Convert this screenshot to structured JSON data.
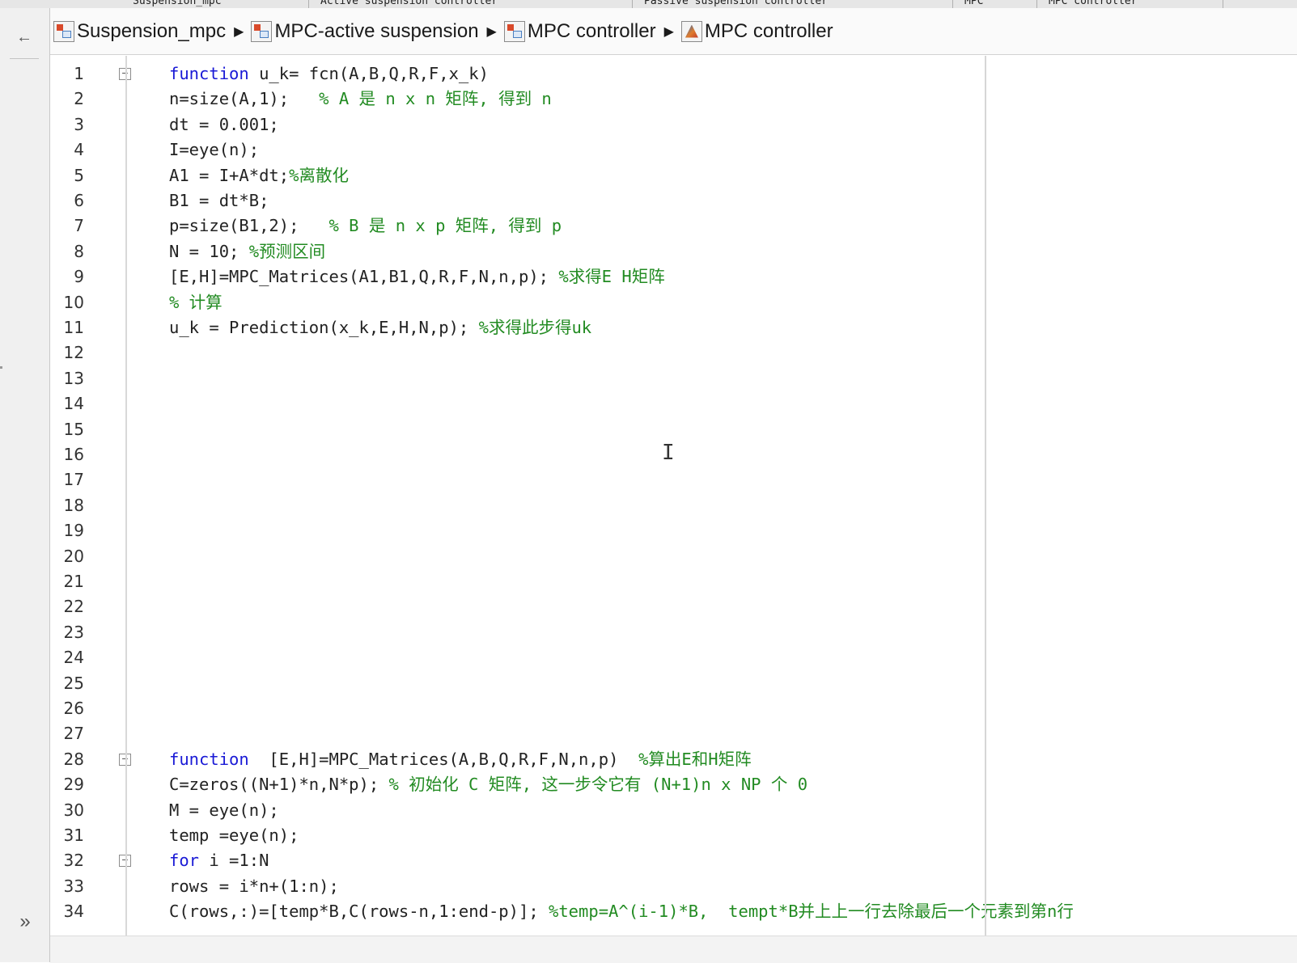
{
  "tabs": [
    {
      "label": "Suspension_mpc"
    },
    {
      "label": "Active suspension controller"
    },
    {
      "label": "Passive suspension controller"
    },
    {
      "label": "MPC"
    },
    {
      "label": "MPC controller"
    }
  ],
  "nav": {
    "back_icon": "back-arrow-icon",
    "expand_icon": "double-chevron-right-icon"
  },
  "breadcrumb": [
    {
      "label": "Suspension_mpc",
      "icon": "simulink-model-icon"
    },
    {
      "label": "MPC-active suspension",
      "icon": "subsystem-icon"
    },
    {
      "label": "MPC controller",
      "icon": "subsystem-icon"
    },
    {
      "label": "MPC controller",
      "icon": "matlab-function-icon"
    }
  ],
  "code": [
    {
      "n": "1",
      "fold": true,
      "kw": "function",
      "text": " u_k= fcn(A,B,Q,R,F,x_k)",
      "comment": ""
    },
    {
      "n": "2",
      "fold": false,
      "kw": "",
      "text": "n=size(A,1);   ",
      "comment": "% A 是 n x n 矩阵, 得到 n"
    },
    {
      "n": "3",
      "fold": false,
      "kw": "",
      "text": "dt = 0.001;",
      "comment": ""
    },
    {
      "n": "4",
      "fold": false,
      "kw": "",
      "text": "I=eye(n);",
      "comment": ""
    },
    {
      "n": "5",
      "fold": false,
      "kw": "",
      "text": "A1 = I+A*dt;",
      "comment": "%离散化"
    },
    {
      "n": "6",
      "fold": false,
      "kw": "",
      "text": "B1 = dt*B;",
      "comment": ""
    },
    {
      "n": "7",
      "fold": false,
      "kw": "",
      "text": "p=size(B1,2);   ",
      "comment": "% B 是 n x p 矩阵, 得到 p"
    },
    {
      "n": "8",
      "fold": false,
      "kw": "",
      "text": "N = 10; ",
      "comment": "%预测区间"
    },
    {
      "n": "9",
      "fold": false,
      "kw": "",
      "text": "[E,H]=MPC_Matrices(A1,B1,Q,R,F,N,n,p); ",
      "comment": "%求得E H矩阵"
    },
    {
      "n": "10",
      "fold": false,
      "kw": "",
      "text": "",
      "comment": "% 计算"
    },
    {
      "n": "11",
      "fold": false,
      "kw": "",
      "text": "u_k = Prediction(x_k,E,H,N,p); ",
      "comment": "%求得此步得uk"
    },
    {
      "n": "12",
      "fold": false,
      "kw": "",
      "text": "",
      "comment": ""
    },
    {
      "n": "13",
      "fold": false,
      "kw": "",
      "text": "",
      "comment": ""
    },
    {
      "n": "14",
      "fold": false,
      "kw": "",
      "text": "",
      "comment": ""
    },
    {
      "n": "15",
      "fold": false,
      "kw": "",
      "text": "",
      "comment": ""
    },
    {
      "n": "16",
      "fold": false,
      "kw": "",
      "text": "",
      "comment": ""
    },
    {
      "n": "17",
      "fold": false,
      "kw": "",
      "text": "",
      "comment": ""
    },
    {
      "n": "18",
      "fold": false,
      "kw": "",
      "text": "",
      "comment": ""
    },
    {
      "n": "19",
      "fold": false,
      "kw": "",
      "text": "",
      "comment": ""
    },
    {
      "n": "20",
      "fold": false,
      "kw": "",
      "text": "",
      "comment": ""
    },
    {
      "n": "21",
      "fold": false,
      "kw": "",
      "text": "",
      "comment": ""
    },
    {
      "n": "22",
      "fold": false,
      "kw": "",
      "text": "",
      "comment": ""
    },
    {
      "n": "23",
      "fold": false,
      "kw": "",
      "text": "",
      "comment": ""
    },
    {
      "n": "24",
      "fold": false,
      "kw": "",
      "text": "",
      "comment": ""
    },
    {
      "n": "25",
      "fold": false,
      "kw": "",
      "text": "",
      "comment": ""
    },
    {
      "n": "26",
      "fold": false,
      "kw": "",
      "text": "",
      "comment": ""
    },
    {
      "n": "27",
      "fold": false,
      "kw": "",
      "text": "",
      "comment": ""
    },
    {
      "n": "28",
      "fold": true,
      "kw": "function",
      "text": "  [E,H]=MPC_Matrices(A,B,Q,R,F,N,n,p)  ",
      "comment": "%算出E和H矩阵"
    },
    {
      "n": "29",
      "fold": false,
      "kw": "",
      "text": "C=zeros((N+1)*n,N*p); ",
      "comment": "% 初始化 C 矩阵, 这一步令它有 (N+1)n x NP 个 0"
    },
    {
      "n": "30",
      "fold": false,
      "kw": "",
      "text": "M = eye(n);",
      "comment": ""
    },
    {
      "n": "31",
      "fold": false,
      "kw": "",
      "text": "temp =eye(n);",
      "comment": ""
    },
    {
      "n": "32",
      "fold": true,
      "kw": "for",
      "text": " i =1:N",
      "comment": ""
    },
    {
      "n": "33",
      "fold": false,
      "kw": "",
      "text": "rows = i*n+(1:n);",
      "comment": ""
    },
    {
      "n": "34",
      "fold": false,
      "kw": "",
      "text": "C(rows,:)=[temp*B,C(rows-n,1:end-p)]; ",
      "comment": "%temp=A^(i-1)*B,  tempt*B并上上一行去除最后一个元素到第n行"
    }
  ],
  "colors": {
    "keyword": "#1a1ad6",
    "comment": "#228b22",
    "text": "#222222"
  }
}
